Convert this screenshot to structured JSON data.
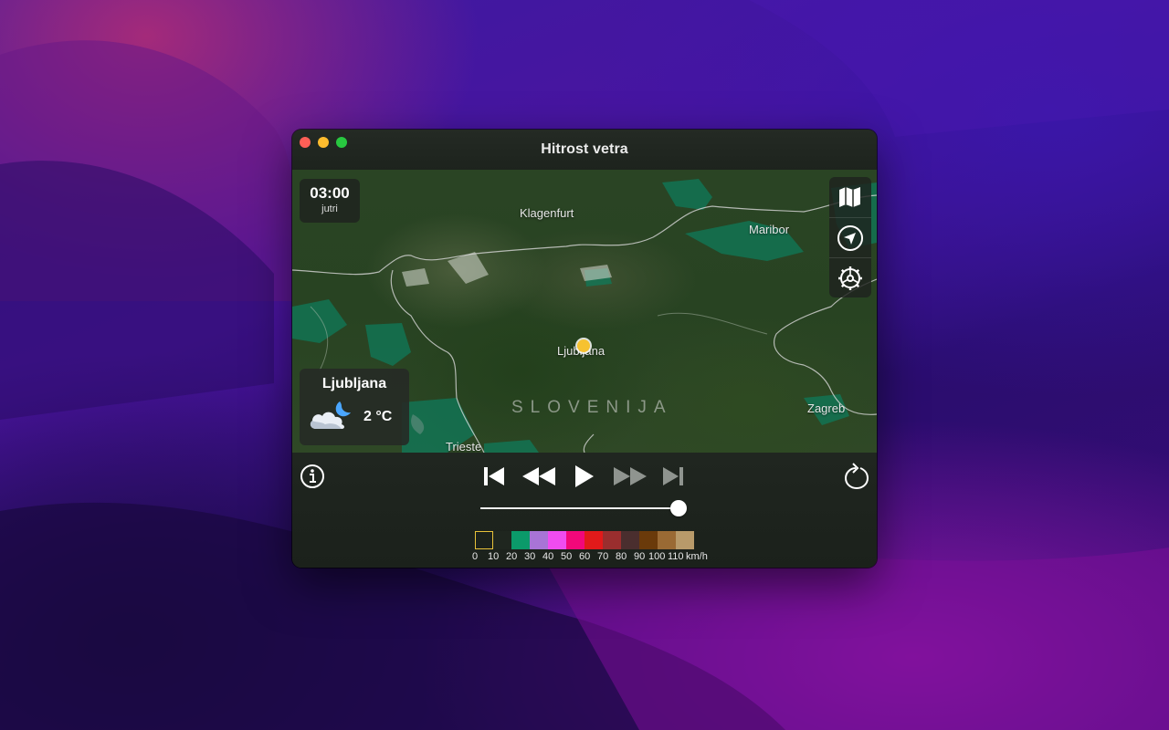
{
  "window": {
    "title": "Hitrost vetra"
  },
  "map": {
    "time": "03:00",
    "day": "jutri",
    "labels": {
      "klagenfurt": "Klagenfurt",
      "maribor": "Maribor",
      "ljubljana": "Ljubljana",
      "country": "SLOVENIJA",
      "zagreb": "Zagreb",
      "trieste": "Trieste"
    },
    "location": {
      "name": "Ljubljana",
      "temperature": "2 °C",
      "weather_icon": "partly-cloudy-night-icon"
    }
  },
  "side_tools": [
    {
      "icon": "map-icon"
    },
    {
      "icon": "location-arrow-icon"
    },
    {
      "icon": "settings-gear-icon"
    }
  ],
  "playback": {
    "buttons": [
      "skip-to-start-icon",
      "rewind-icon",
      "play-icon",
      "fast-forward-icon",
      "skip-to-end-icon"
    ],
    "position": 1.0
  },
  "legend": {
    "unit": "km/h",
    "ticks": [
      "0",
      "10",
      "20",
      "30",
      "40",
      "50",
      "60",
      "70",
      "80",
      "90",
      "100",
      "110"
    ],
    "colors": [
      "#1f261f",
      "#1f261f",
      "#0b9a6a",
      "#a874d6",
      "#f04cf0",
      "#f2087a",
      "#e21a1a",
      "#9a2e2e",
      "#4a2e2e",
      "#6a3a0a",
      "#9a6a34",
      "#b89a6a"
    ]
  }
}
